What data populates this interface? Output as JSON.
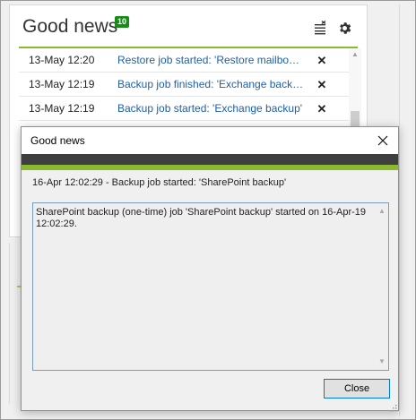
{
  "widget": {
    "title": "Good news",
    "count": "10",
    "icons": [
      "mark-all-read-icon",
      "gear-icon"
    ],
    "items": [
      {
        "date": "13-May 12:20",
        "message": "Restore job started: 'Restore mailbox items'",
        "dismiss": "✕"
      },
      {
        "date": "13-May 12:19",
        "message": "Backup job finished: 'Exchange backup'",
        "dismiss": "✕"
      },
      {
        "date": "13-May 12:19",
        "message": "Backup job started: 'Exchange backup'",
        "dismiss": "✕"
      }
    ]
  },
  "dialog": {
    "title": "Good news",
    "heading": "16-Apr 12:02:29 - Backup job started: 'SharePoint backup'",
    "details": "SharePoint backup (one-time) job 'SharePoint backup' started on 16-Apr-19 12:02:29.",
    "close_button": "Close"
  },
  "colors": {
    "accent_green": "#8ab82e",
    "badge_green": "#1a8a1a",
    "link_blue": "#1f5fa8",
    "dialog_dark_bar": "#3f3f3f"
  }
}
